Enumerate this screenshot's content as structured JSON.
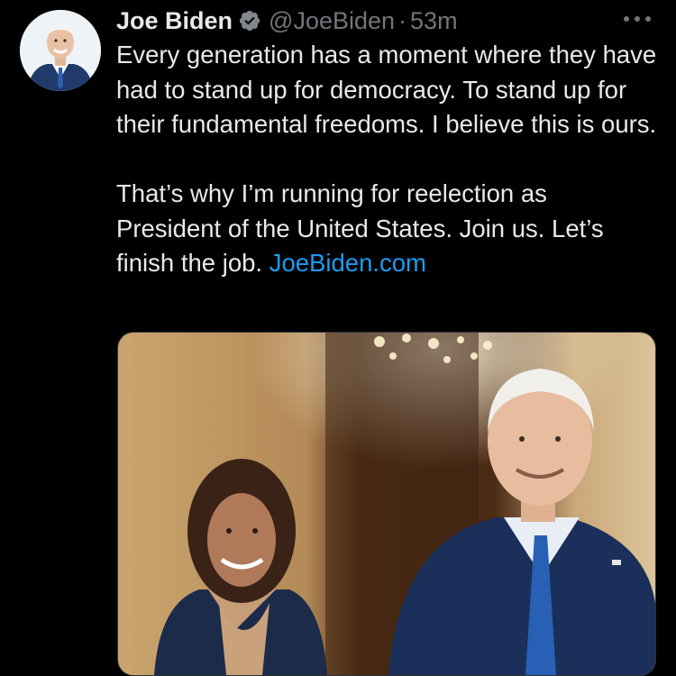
{
  "tweet": {
    "author_name": "Joe Biden",
    "handle": "@JoeBiden",
    "separator": "·",
    "time": "53m",
    "paragraph1": "Every generation has a moment where they have had to stand up for democracy. To stand up for their fundamental freedoms. I believe this is ours.",
    "paragraph2_text": "That’s why I’m running for reelection as President of the United States. Join us. Let’s finish the job. ",
    "link_text": "JoeBiden.com"
  },
  "icons": {
    "verified": "verified-badge-icon",
    "more": "more-options-icon"
  },
  "colors": {
    "background": "#000000",
    "text": "#e7e9ea",
    "secondary": "#71767b",
    "link": "#1d9bf0"
  }
}
